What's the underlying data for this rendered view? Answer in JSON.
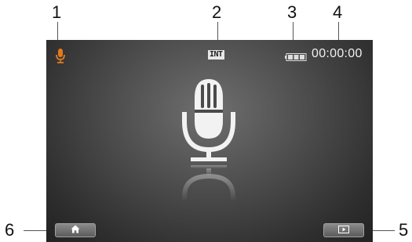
{
  "callouts": {
    "c1": "1",
    "c2": "2",
    "c3": "3",
    "c4": "4",
    "c5": "5",
    "c6": "6"
  },
  "status_bar": {
    "mic_indicator_icon": "microphone-icon",
    "storage_label": "INT",
    "battery_icon": "battery-icon",
    "timer": "00:00:00"
  },
  "center": {
    "icon": "microphone-icon"
  },
  "buttons": {
    "home_icon": "home-icon",
    "play_icon": "play-icon"
  },
  "colors": {
    "mic_indicator": "#e07a1f",
    "screen_bg": "#3a3a3a",
    "text": "#f0f0f0"
  }
}
